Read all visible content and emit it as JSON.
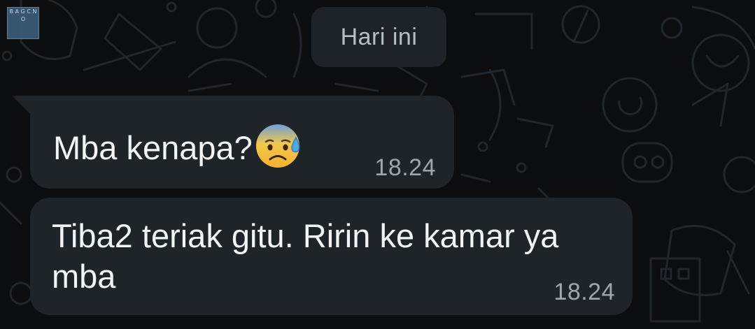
{
  "corner_logo": {
    "text": "B A G C N O"
  },
  "date_chip": {
    "label": "Hari ini"
  },
  "messages": [
    {
      "text": "Mba kenapa?",
      "emoji": "anxious-face-with-sweat-icon",
      "time": "18.24"
    },
    {
      "text": "Tiba2 teriak gitu. Ririn ke kamar ya mba",
      "time": "18.24"
    }
  ],
  "colors": {
    "background": "#0b0d0e",
    "bubble": "#1f2428",
    "date_chip": "#1d2327",
    "text": "#f2f4f5",
    "timestamp": "#9fa7ac"
  }
}
